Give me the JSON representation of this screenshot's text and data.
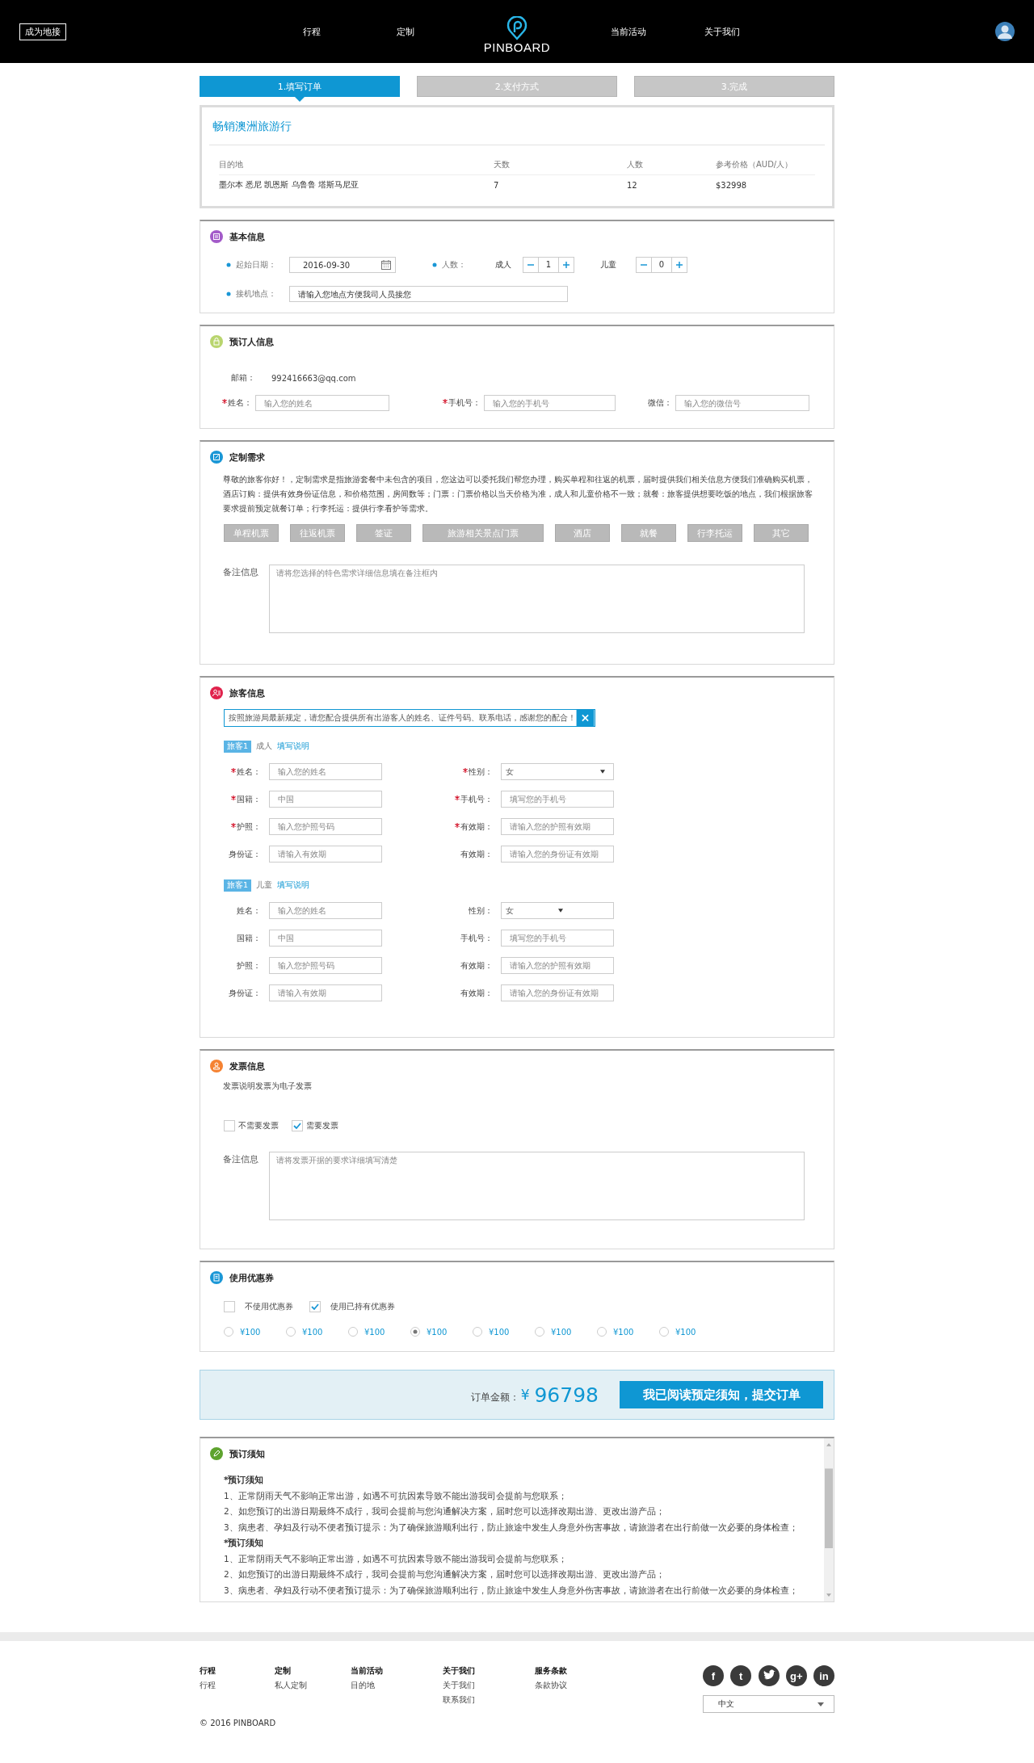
{
  "header": {
    "guide_button": "成为地接",
    "nav_left": [
      "行程",
      "定制"
    ],
    "logo_text": "PINBOARD",
    "nav_right": [
      "当前活动",
      "关于我们"
    ]
  },
  "steps": [
    {
      "label": "1.填写订单",
      "selected": true
    },
    {
      "label": "2.支付方式",
      "selected": false
    },
    {
      "label": "3.完成",
      "selected": false
    }
  ],
  "trip": {
    "title": "畅销澳洲旅游行",
    "columns": [
      "目的地",
      "天数",
      "人数",
      "参考价格（AUD/人）"
    ],
    "row": [
      "墨尔本 悉尼 凯恩斯 乌鲁鲁 塔斯马尼亚",
      "7",
      "12",
      "$32998"
    ]
  },
  "basic_info": {
    "title": "基本信息",
    "color": "#a35bc9",
    "date_label": "起始日期：",
    "date_value": "2016-09-30",
    "people_label": "人数：",
    "steppers": [
      {
        "label": "成人",
        "value": "1"
      },
      {
        "label": "儿童",
        "value": "0"
      }
    ],
    "pickup_label": "接机地点：",
    "pickup_placeholder": "请输入您地点方便我司人员接您"
  },
  "booker": {
    "title": "预订人信息",
    "color": "#b9d56e",
    "email_label": "邮箱：",
    "email": "992416663@qq.com",
    "fields": [
      {
        "label": "姓名：",
        "required": true,
        "placeholder": "输入您的姓名"
      },
      {
        "label": "手机号：",
        "required": true,
        "placeholder": "输入您的手机号"
      },
      {
        "label": "微信：",
        "required": false,
        "placeholder": "输入您的微信号"
      }
    ]
  },
  "custom": {
    "title": "定制需求",
    "color": "#1a97d6",
    "intro": "尊敬的旅客你好！，定制需求是指旅游套餐中未包含的项目，您这边可以委托我们帮您办理，购买单程和往返的机票，届时提供我们相关信息方便我们准确购买机票，酒店订购：提供有效身份证信息，和价格范围，房间数等；门票：门票价格以当天价格为准，成人和儿童价格不一致；就餐：旅客提供想要吃饭的地点，我们根据旅客要求提前预定就餐订单；行李托运：提供行李看护等需求。",
    "tags": [
      "单程机票",
      "往返机票",
      "签证",
      "旅游相关景点门票",
      "酒店",
      "就餐",
      "行李托运",
      "其它"
    ],
    "note_label": "备注信息",
    "note_placeholder": "请将您选择的特色需求详细信息填在备注框内"
  },
  "travelers": {
    "title": "旅客信息",
    "color": "#e0224c",
    "notice": "按照旅游局最新规定，请您配合提供所有出游客人的姓名、证件号码、联系电话，感谢您的配合！",
    "groups": [
      {
        "badge": "旅客1",
        "type": "成人",
        "help_link": "填写说明",
        "fields": [
          {
            "label": "姓名：",
            "required": true,
            "kind": "input",
            "placeholder": "输入您的姓名"
          },
          {
            "label": "性别：",
            "required": true,
            "kind": "select",
            "value": "女"
          },
          {
            "label": "国籍：",
            "required": true,
            "kind": "input",
            "placeholder": "中国"
          },
          {
            "label": "手机号：",
            "required": true,
            "kind": "input",
            "placeholder": "填写您的手机号"
          },
          {
            "label": "护照：",
            "required": true,
            "kind": "input",
            "placeholder": "输入您护照号码"
          },
          {
            "label": "有效期：",
            "required": true,
            "kind": "input",
            "placeholder": "请输入您的护照有效期"
          },
          {
            "label": "身份证：",
            "required": false,
            "kind": "input",
            "placeholder": "请输入有效期"
          },
          {
            "label": "有效期：",
            "required": false,
            "kind": "input",
            "placeholder": "请输入您的身份证有效期"
          }
        ]
      },
      {
        "badge": "旅客1",
        "type": "儿童",
        "help_link": "填写说明",
        "fields": [
          {
            "label": "姓名：",
            "required": false,
            "kind": "input",
            "placeholder": "输入您的姓名"
          },
          {
            "label": "性别：",
            "required": false,
            "kind": "select",
            "value": "女"
          },
          {
            "label": "国籍：",
            "required": false,
            "kind": "input",
            "placeholder": "中国"
          },
          {
            "label": "手机号：",
            "required": false,
            "kind": "input",
            "placeholder": "填写您的手机号"
          },
          {
            "label": "护照：",
            "required": false,
            "kind": "input",
            "placeholder": "输入您护照号码"
          },
          {
            "label": "有效期：",
            "required": false,
            "kind": "input",
            "placeholder": "请输入您的护照有效期"
          },
          {
            "label": "身份证：",
            "required": false,
            "kind": "input",
            "placeholder": "请输入有效期"
          },
          {
            "label": "有效期：",
            "required": false,
            "kind": "input",
            "placeholder": "请输入您的身份证有效期"
          }
        ]
      }
    ]
  },
  "invoice": {
    "title": "发票信息",
    "color": "#f58232",
    "description": "发票说明发票为电子发票",
    "options": [
      {
        "label": "不需要发票",
        "checked": false
      },
      {
        "label": "需要发票",
        "checked": true
      }
    ],
    "note_label": "备注信息",
    "note_placeholder": "请将发票开据的要求详细填写清楚"
  },
  "coupon": {
    "title": "使用优惠券",
    "color": "#1a97d6",
    "options": [
      {
        "label": "不使用优惠券",
        "checked": false
      },
      {
        "label": "使用已持有优惠券",
        "checked": true
      }
    ],
    "amounts": [
      {
        "label": "¥100",
        "selected": false
      },
      {
        "label": "¥100",
        "selected": false
      },
      {
        "label": "¥100",
        "selected": false
      },
      {
        "label": "¥100",
        "selected": true
      },
      {
        "label": "¥100",
        "selected": false
      },
      {
        "label": "¥100",
        "selected": false
      },
      {
        "label": "¥100",
        "selected": false
      },
      {
        "label": "¥100",
        "selected": false
      }
    ]
  },
  "total": {
    "label": "订单金额：",
    "currency": "¥",
    "amount": "96798",
    "submit_button": "我已阅读预定须知，提交订单"
  },
  "notice": {
    "title": "预订须知",
    "color": "#5ea32e",
    "lines": [
      {
        "kind": "heading",
        "text": "*预订须知"
      },
      {
        "kind": "item",
        "text": "1、正常阴雨天气不影响正常出游，如遇不可抗因素导致不能出游我司会提前与您联系；"
      },
      {
        "kind": "item",
        "text": "2、如您预订的出游日期最终不成行，我司会提前与您沟通解决方案，届时您可以选择改期出游、更改出游产品；"
      },
      {
        "kind": "item",
        "text": "3、病患者、孕妇及行动不便者预订提示：为了确保旅游顺利出行，防止旅途中发生人身意外伤害事故，请旅游者在出行前做一次必要的身体检查；"
      },
      {
        "kind": "heading",
        "text": "*预订须知"
      },
      {
        "kind": "item",
        "text": "1、正常阴雨天气不影响正常出游，如遇不可抗因素导致不能出游我司会提前与您联系；"
      },
      {
        "kind": "item",
        "text": "2、如您预订的出游日期最终不成行，我司会提前与您沟通解决方案，届时您可以选择改期出游、更改出游产品；"
      },
      {
        "kind": "item",
        "text": "3、病患者、孕妇及行动不便者预订提示：为了确保旅游顺利出行，防止旅途中发生人身意外伤害事故，请旅游者在出行前做一次必要的身体检查；"
      }
    ]
  },
  "footer": {
    "columns": [
      {
        "title": "行程",
        "links": [
          "行程"
        ]
      },
      {
        "title": "定制",
        "links": [
          "私人定制"
        ]
      },
      {
        "title": "当前活动",
        "links": [
          "目的地"
        ]
      },
      {
        "title": "关于我们",
        "links": [
          "关于我们",
          "联系我们"
        ]
      },
      {
        "title": "服务条款",
        "links": [
          "条款协议"
        ]
      }
    ],
    "social": [
      {
        "kind": "glyph",
        "label": "f"
      },
      {
        "kind": "glyph",
        "label": "t"
      },
      {
        "kind": "bird"
      },
      {
        "kind": "glyph",
        "label": "g+"
      },
      {
        "kind": "glyph",
        "label": "in"
      }
    ],
    "language": "中文",
    "copyright": "© 2016 PINBOARD"
  }
}
